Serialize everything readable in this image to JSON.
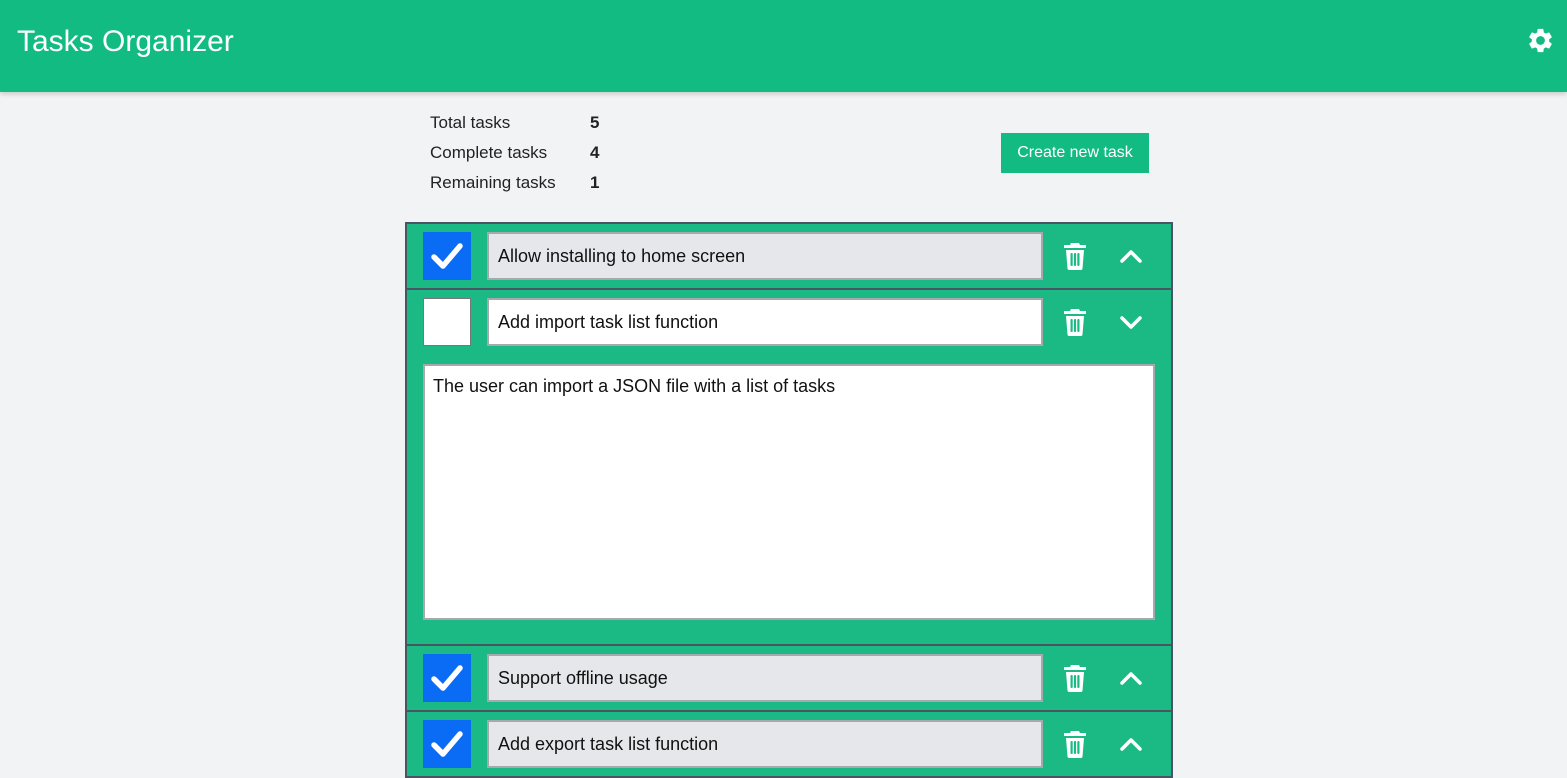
{
  "app": {
    "title": "Tasks Organizer",
    "settings_icon": "gear-icon",
    "brand_color": "#12bb82"
  },
  "stats": {
    "total_label": "Total tasks",
    "total_value": "5",
    "complete_label": "Complete tasks",
    "complete_value": "4",
    "remaining_label": "Remaining tasks",
    "remaining_value": "1"
  },
  "actions": {
    "create_label": "Create new task"
  },
  "tasks": [
    {
      "name": "Allow installing to home screen",
      "done": true,
      "expanded": false
    },
    {
      "name": "Add import task list function",
      "done": false,
      "expanded": true,
      "description": "The user can import a JSON file with a list of tasks"
    },
    {
      "name": "Support offline usage",
      "done": true,
      "expanded": false
    },
    {
      "name": "Add export task list function",
      "done": true,
      "expanded": false
    }
  ],
  "colors": {
    "checked": "#0a6cf5",
    "task_bg": "#1bba84"
  }
}
